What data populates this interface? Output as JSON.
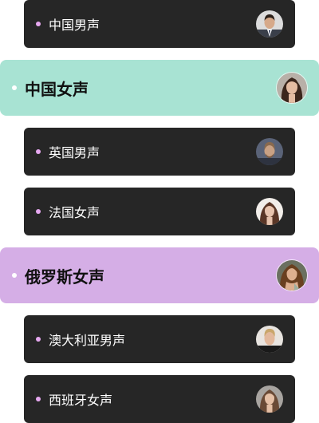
{
  "voices": [
    {
      "label": "中国男声",
      "avatar": "male-portrait-icon",
      "state": "collapsed"
    },
    {
      "label": "中国女声",
      "avatar": "female-portrait-icon",
      "state": "selected",
      "accent": "#a8e3d3"
    },
    {
      "label": "英国男声",
      "avatar": "male-portrait-icon",
      "state": "collapsed"
    },
    {
      "label": "法国女声",
      "avatar": "female-portrait-icon",
      "state": "collapsed"
    },
    {
      "label": "俄罗斯女声",
      "avatar": "female-portrait-icon",
      "state": "selected",
      "accent": "#d5aee6"
    },
    {
      "label": "澳大利亚男声",
      "avatar": "male-portrait-icon",
      "state": "collapsed"
    },
    {
      "label": "西班牙女声",
      "avatar": "female-portrait-icon",
      "state": "collapsed"
    }
  ],
  "colors": {
    "card_dark": "#262626",
    "dot_compact": "#e6a8f0",
    "text_light": "#ffffff",
    "text_dark": "#111111"
  }
}
